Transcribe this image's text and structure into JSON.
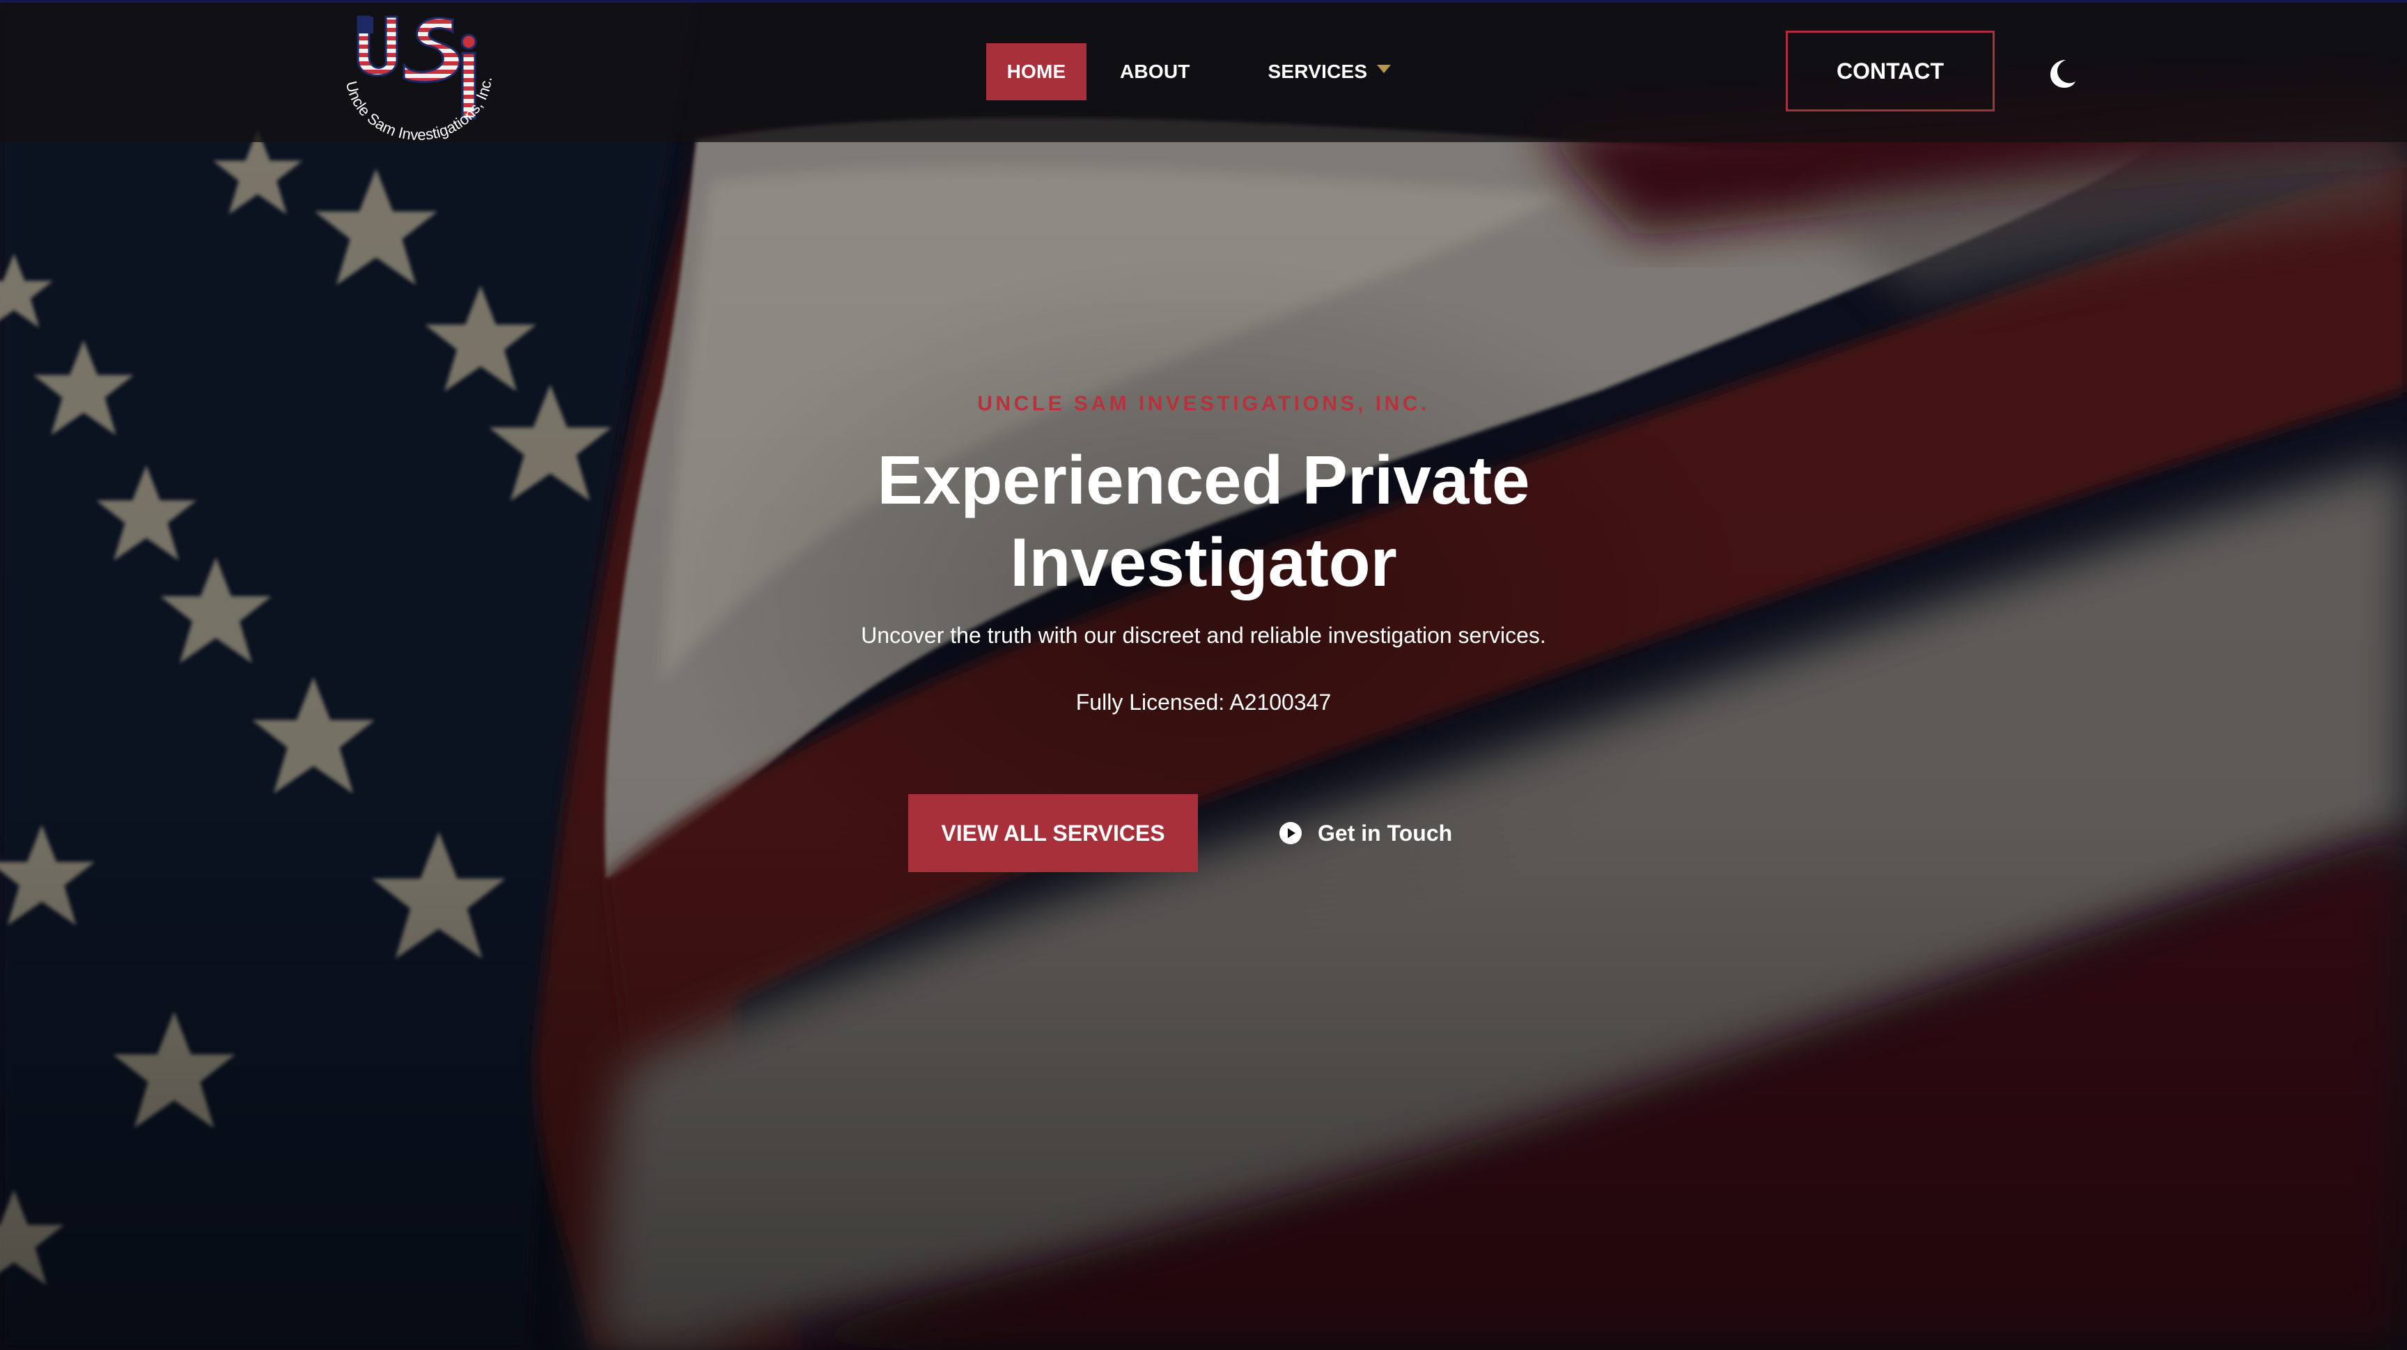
{
  "brand": {
    "logo_monogram": "USI",
    "logo_ring_text": "Uncle Sam Investigations, Inc.",
    "colors": {
      "accent": "#a8303a",
      "eyebrow": "#b8323c",
      "caret": "#b8964a",
      "text": "#ffffff"
    }
  },
  "nav": {
    "items": [
      {
        "label": "HOME",
        "active": true
      },
      {
        "label": "ABOUT",
        "active": false
      },
      {
        "label": "SERVICES",
        "active": false,
        "has_dropdown": true
      }
    ],
    "contact_label": "CONTACT",
    "theme_toggle_icon": "moon-icon"
  },
  "hero": {
    "eyebrow": "UNCLE SAM INVESTIGATIONS, INC.",
    "title": "Experienced Private Investigator",
    "subtitle": "Uncover the truth with our discreet and reliable investigation services.",
    "license": "Fully Licensed: A2100347",
    "primary_button": "VIEW ALL SERVICES",
    "secondary_button": "Get in Touch",
    "secondary_icon": "play-circle-icon",
    "background": "american-flag-photo"
  }
}
